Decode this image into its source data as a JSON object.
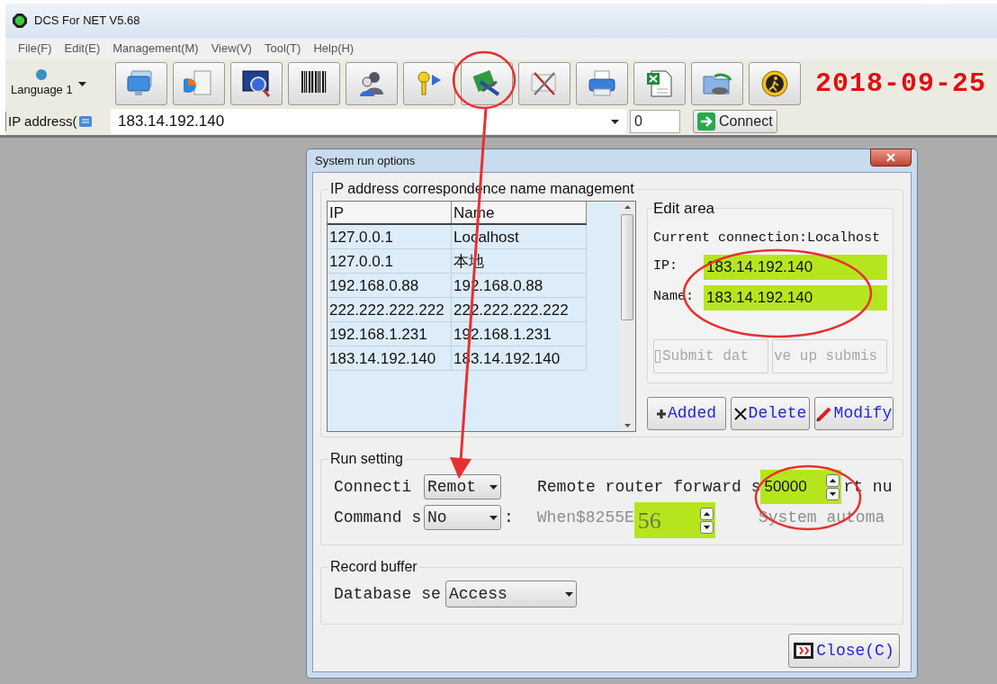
{
  "window": {
    "title": "DCS For NET V5.68"
  },
  "menu": [
    "File(F)",
    "Edit(E)",
    "Management(M)",
    "View(V)",
    "Tool(T)",
    "Help(H)"
  ],
  "toolbar": {
    "language": "Language 1",
    "date": "2018-09-25"
  },
  "address_bar": {
    "label": "IP address(",
    "value": "183.14.192.140",
    "port": "0",
    "button": "Connect"
  },
  "dialog": {
    "title": "System run options",
    "ip_names": {
      "title": "IP address correspondence name management",
      "columns": [
        "IP",
        "Name"
      ],
      "rows": [
        [
          "127.0.0.1",
          "Localhost"
        ],
        [
          "127.0.0.1",
          "本地"
        ],
        [
          "192.168.0.88",
          "192.168.0.88"
        ],
        [
          "222.222.222.222",
          "222.222.222.222"
        ],
        [
          "192.168.1.231",
          "192.168.1.231"
        ],
        [
          "183.14.192.140",
          "183.14.192.140"
        ]
      ]
    },
    "edit_area": {
      "title": "Edit area",
      "current": "Current connection:Localhost",
      "ip_label": "IP:",
      "ip_value": "183.14.192.140",
      "name_label": "Name:",
      "name_value": "183.14.192.140",
      "actions": [
        {
          "label": "Submit dat",
          "disabled": true
        },
        {
          "label": "ve up submis",
          "disabled": true
        }
      ]
    },
    "list_buttons": [
      {
        "label": "Added",
        "kind": "add"
      },
      {
        "label": "Delete",
        "kind": "delete"
      },
      {
        "label": "Modify",
        "kind": "modify"
      }
    ],
    "run_setting": {
      "title": "Run setting",
      "connection_label": "Connecti",
      "connection_value": "Remot",
      "forward_label": "Remote router forward s",
      "forward_value": "50000",
      "forward_suffix": "rt nu",
      "command_label": "Command s",
      "command_value": "No",
      "command_colon": ":",
      "when_label": "When$8255E",
      "when_value": "56",
      "when_disabled": true,
      "system_label": "System automa",
      "system_disabled": true
    },
    "record_buffer": {
      "title": "Record buffer",
      "database_label": "Database se",
      "database_value": "Access"
    },
    "close": "Close(C)"
  }
}
